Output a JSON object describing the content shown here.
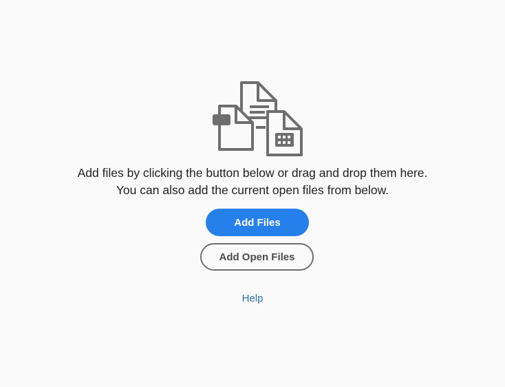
{
  "empty_state": {
    "icon": "multiple-files-icon",
    "line1": "Add files by clicking the button below or drag and drop them here.",
    "line2": "You can also add the current open files from below."
  },
  "actions": {
    "add_files_label": "Add Files",
    "add_open_files_label": "Add Open Files",
    "help_label": "Help"
  },
  "colors": {
    "background": "#fafafa",
    "primary_button": "#2680eb",
    "icon_gray": "#6e6e6e",
    "link": "#2d6fb6"
  }
}
